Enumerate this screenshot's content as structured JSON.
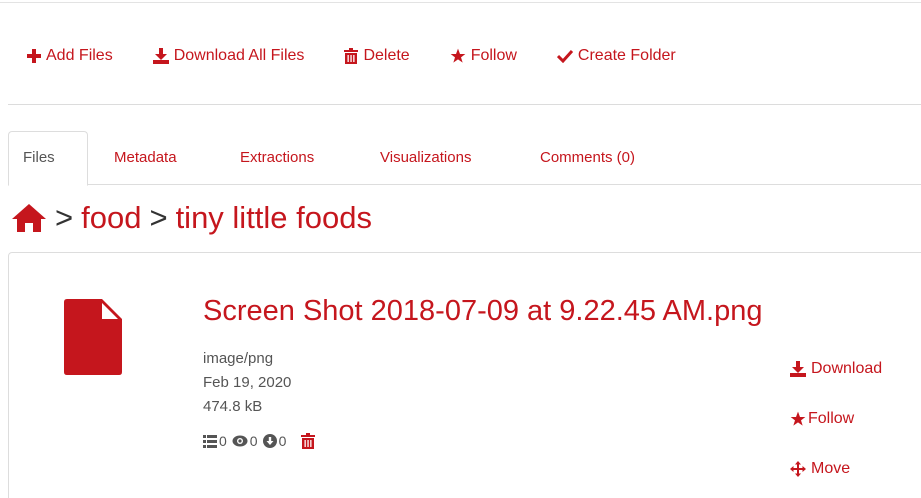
{
  "toolbar": {
    "add_files": "Add Files",
    "download_all": "Download All Files",
    "delete": "Delete",
    "follow": "Follow",
    "create_folder": "Create Folder"
  },
  "tabs": [
    {
      "label": "Files",
      "active": true
    },
    {
      "label": "Metadata",
      "active": false
    },
    {
      "label": "Extractions",
      "active": false
    },
    {
      "label": "Visualizations",
      "active": false
    },
    {
      "label": "Comments (0)",
      "active": false
    }
  ],
  "breadcrumb": {
    "separator": ">",
    "items": [
      "food",
      "tiny little foods"
    ]
  },
  "file": {
    "name": "Screen Shot 2018-07-09 at 9.22.45 AM.png",
    "type": "image/png",
    "date": "Feb 19, 2020",
    "size": "474.8 kB",
    "metadata_count": "0",
    "views_count": "0",
    "downloads_count": "0"
  },
  "file_actions": {
    "download": "Download",
    "follow": "Follow",
    "move": "Move"
  },
  "colors": {
    "accent": "#c5161d",
    "text": "#555555",
    "border": "#dddddd"
  },
  "icons": [
    "plus-icon",
    "download-icon",
    "trash-icon",
    "star-icon",
    "check-icon",
    "home-icon",
    "file-icon",
    "list-icon",
    "eye-icon",
    "download-circle-icon",
    "move-icon"
  ]
}
